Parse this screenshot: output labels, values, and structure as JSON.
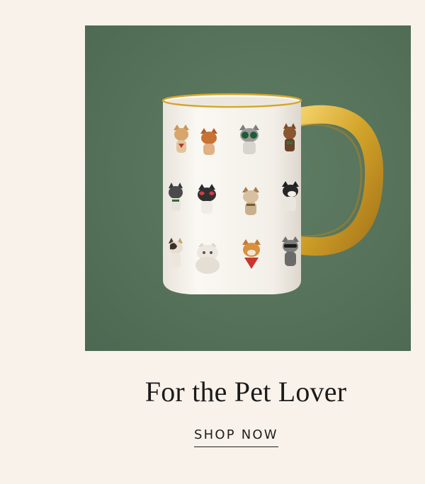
{
  "promo": {
    "headline": "For the Pet Lover",
    "cta_label": "SHOP NOW"
  },
  "image": {
    "name": "cat-mug-photo",
    "background_color": "#5a765e",
    "mug_color": "#f7f4ee",
    "handle_color": "#d4a52a"
  },
  "page": {
    "background_color": "#f9f2ea"
  }
}
